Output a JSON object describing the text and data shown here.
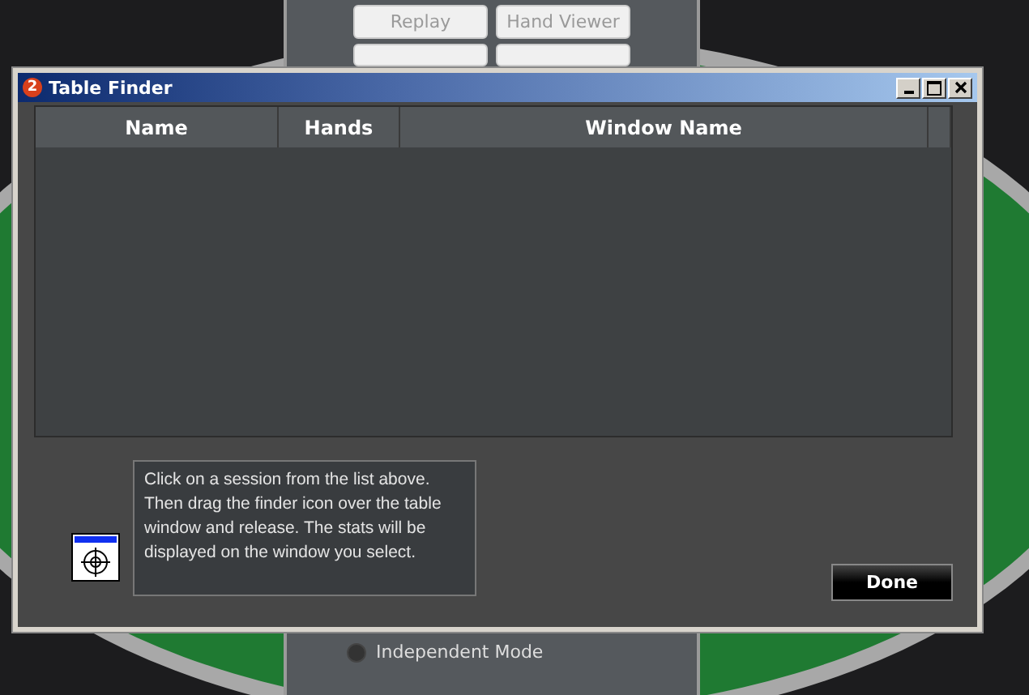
{
  "background_panel": {
    "buttons": [
      {
        "label": "Replay",
        "disabled": true
      },
      {
        "label": "Hand Viewer",
        "disabled": true
      }
    ],
    "radio": {
      "label": "Independent Mode",
      "selected": false
    }
  },
  "window": {
    "badge": "2",
    "title": "Table Finder"
  },
  "table": {
    "columns": [
      "Name",
      "Hands",
      "Window Name"
    ]
  },
  "instructions": "Click on a session from the list above. Then drag the finder icon over the table window and release. The stats will be displayed on the window you select.",
  "buttons": [
    "Done"
  ]
}
